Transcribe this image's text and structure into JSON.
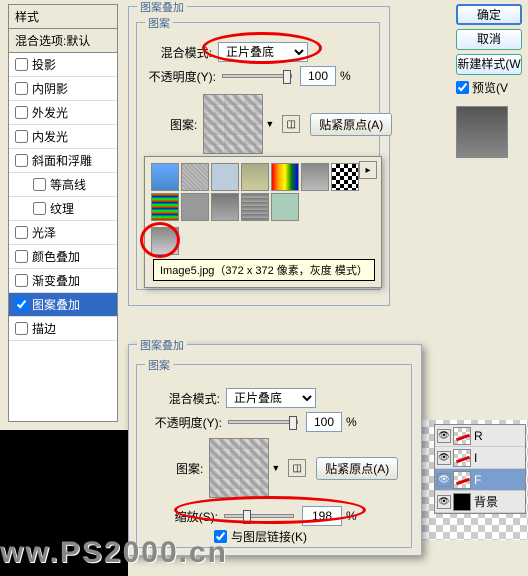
{
  "left": {
    "header": "样式",
    "sub": "混合选项:默认",
    "items": [
      {
        "label": "投影",
        "checked": false
      },
      {
        "label": "内阴影",
        "checked": false
      },
      {
        "label": "外发光",
        "checked": false
      },
      {
        "label": "内发光",
        "checked": false
      },
      {
        "label": "斜面和浮雕",
        "checked": false
      },
      {
        "label": "等高线",
        "checked": false,
        "indent": true
      },
      {
        "label": "纹理",
        "checked": false,
        "indent": true
      },
      {
        "label": "光泽",
        "checked": false
      },
      {
        "label": "颜色叠加",
        "checked": false
      },
      {
        "label": "渐变叠加",
        "checked": false
      },
      {
        "label": "图案叠加",
        "checked": true,
        "selected": true
      },
      {
        "label": "描边",
        "checked": false
      }
    ]
  },
  "top": {
    "outer_title": "图案叠加",
    "inner_title": "图案",
    "blend_label": "混合模式:",
    "blend_value": "正片叠底",
    "opacity_label": "不透明度(Y):",
    "opacity_value": "100",
    "pct": "%",
    "pattern_label": "图案:",
    "snap_btn": "贴紧原点(A)"
  },
  "swatches": {
    "tooltip": "Image5.jpg（372 x 372 像素，灰度 模式）"
  },
  "bottom": {
    "outer_title": "图案叠加",
    "inner_title": "图案",
    "blend_label": "混合模式:",
    "blend_value": "正片叠底",
    "opacity_label": "不透明度(Y):",
    "opacity_value": "100",
    "pct": "%",
    "pattern_label": "图案:",
    "snap_btn": "贴紧原点(A)",
    "scale_label": "缩放(S):",
    "scale_value": "198",
    "link_label": "与图层链接(K)"
  },
  "right": {
    "ok": "确定",
    "cancel": "取消",
    "new_style": "新建样式(W",
    "preview": "预览(V"
  },
  "layers": {
    "items": [
      {
        "name": "R"
      },
      {
        "name": "I"
      },
      {
        "name": "F",
        "selected": true
      },
      {
        "name": "背景",
        "bg": true
      }
    ]
  },
  "watermark": "ww.PS2000.cn"
}
